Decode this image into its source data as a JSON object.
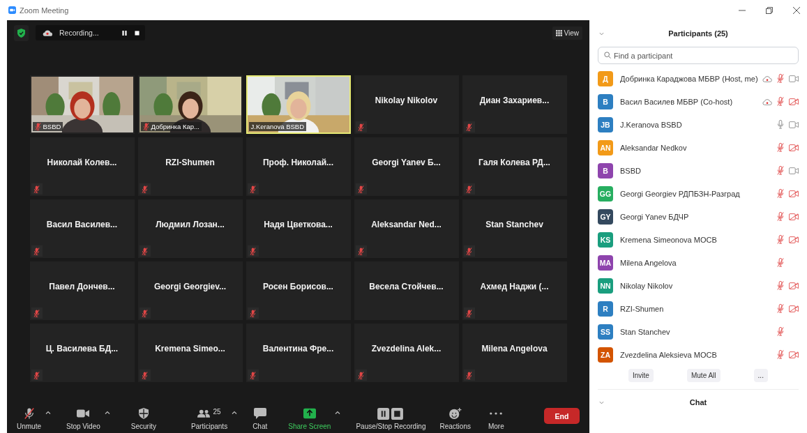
{
  "window": {
    "title": "Zoom Meeting"
  },
  "recording": {
    "label": "Recording..."
  },
  "view_button": {
    "label": "View"
  },
  "tiles": [
    {
      "name": "BSBD",
      "kind": "picture",
      "muted": true,
      "active": false
    },
    {
      "name": "Добринка Кар...",
      "kind": "picture",
      "muted": true,
      "active": false
    },
    {
      "name": "J.Keranova BSBD",
      "kind": "picture",
      "muted": false,
      "active": true
    },
    {
      "name": "Nikolay Nikolov",
      "kind": "name",
      "muted": true,
      "active": false
    },
    {
      "name": "Диан Захариев...",
      "kind": "name",
      "muted": true,
      "active": false
    },
    {
      "name": "Николай Колев...",
      "kind": "name",
      "muted": true,
      "active": false
    },
    {
      "name": "RZI-Shumen",
      "kind": "name",
      "muted": true,
      "active": false
    },
    {
      "name": "Проф. Николай...",
      "kind": "name",
      "muted": true,
      "active": false
    },
    {
      "name": "Georgi Yanev Б...",
      "kind": "name",
      "muted": true,
      "active": false
    },
    {
      "name": "Галя Колева РД...",
      "kind": "name",
      "muted": true,
      "active": false
    },
    {
      "name": "Васил Василев...",
      "kind": "name",
      "muted": true,
      "active": false
    },
    {
      "name": "Людмил Лозан...",
      "kind": "name",
      "muted": true,
      "active": false
    },
    {
      "name": "Надя Цветкова...",
      "kind": "name",
      "muted": true,
      "active": false
    },
    {
      "name": "Aleksandar Ned...",
      "kind": "name",
      "muted": true,
      "active": false
    },
    {
      "name": "Stan Stanchev",
      "kind": "name",
      "muted": true,
      "active": false
    },
    {
      "name": "Павел Дончев...",
      "kind": "name",
      "muted": true,
      "active": false
    },
    {
      "name": "Georgi Georgiev...",
      "kind": "name",
      "muted": true,
      "active": false
    },
    {
      "name": "Росен Борисов...",
      "kind": "name",
      "muted": true,
      "active": false
    },
    {
      "name": "Весела Стойчев...",
      "kind": "name",
      "muted": false,
      "active": false
    },
    {
      "name": "Ахмед Наджи (...",
      "kind": "name",
      "muted": true,
      "active": false
    },
    {
      "name": "Ц. Василева БД...",
      "kind": "name",
      "muted": true,
      "active": false
    },
    {
      "name": "Kremena Simeo...",
      "kind": "name",
      "muted": true,
      "active": false
    },
    {
      "name": "Валентина Фре...",
      "kind": "name",
      "muted": true,
      "active": false
    },
    {
      "name": "Zvezdelina Alek...",
      "kind": "name",
      "muted": true,
      "active": false
    },
    {
      "name": "Milena Angelova",
      "kind": "name",
      "muted": true,
      "active": false
    }
  ],
  "toolbar": [
    {
      "kind": "mic",
      "label": "Unmute",
      "muted": true,
      "caret": true
    },
    {
      "kind": "video",
      "label": "Stop Video",
      "caret": true
    },
    {
      "kind": "security",
      "label": "Security",
      "caret": false
    },
    {
      "kind": "participants",
      "label": "Participants",
      "count": "25",
      "caret": true
    },
    {
      "kind": "chat",
      "label": "Chat",
      "caret": false
    },
    {
      "kind": "share",
      "label": "Share Screen",
      "caret": true
    },
    {
      "kind": "record",
      "label": "Pause/Stop Recording",
      "caret": false
    },
    {
      "kind": "reactions",
      "label": "Reactions",
      "caret": false
    },
    {
      "kind": "more",
      "label": "More",
      "caret": false
    }
  ],
  "end_button": {
    "label": "End"
  },
  "participants_panel": {
    "title": "Participants (25)",
    "search": {
      "placeholder": "Find a participant"
    },
    "participants": [
      {
        "initials": "Д",
        "color": "#f29a18",
        "name": "Добринка Караджова МБВР (Host, me)",
        "recording": true,
        "mic_muted": true,
        "video_on": true
      },
      {
        "initials": "В",
        "color": "#2d7fc1",
        "name": "Васил Василев МБВР (Co-host)",
        "recording": true,
        "mic_muted": true,
        "video_on": false
      },
      {
        "initials": "JB",
        "color": "#2d7fc1",
        "name": "J.Keranova BSBD",
        "recording": false,
        "mic_muted": false,
        "video_on": true
      },
      {
        "initials": "AN",
        "color": "#f29a18",
        "name": "Aleksandar Nedkov",
        "recording": false,
        "mic_muted": true,
        "video_on": false
      },
      {
        "initials": "B",
        "color": "#8e44ad",
        "name": "BSBD",
        "recording": false,
        "mic_muted": true,
        "video_on": true
      },
      {
        "initials": "GG",
        "color": "#27ae60",
        "name": "Georgi Georgiev РДПБЗН-Разград",
        "recording": false,
        "mic_muted": true,
        "video_on": false
      },
      {
        "initials": "GY",
        "color": "#34495e",
        "name": "Georgi Yanev БДЧР",
        "recording": false,
        "mic_muted": true,
        "video_on": false
      },
      {
        "initials": "KS",
        "color": "#1a9e7e",
        "name": "Kremena Simeonova МОСВ",
        "recording": false,
        "mic_muted": true,
        "video_on": false
      },
      {
        "initials": "MA",
        "color": "#8e44ad",
        "name": "Milena Angelova",
        "recording": false,
        "mic_muted": true
      },
      {
        "initials": "NN",
        "color": "#1a9e7e",
        "name": "Nikolay Nikolov",
        "recording": false,
        "mic_muted": true,
        "video_on": false
      },
      {
        "initials": "R",
        "color": "#2d7fc1",
        "name": "RZI-Shumen",
        "recording": false,
        "mic_muted": true,
        "video_on": false
      },
      {
        "initials": "SS",
        "color": "#2d7fc1",
        "name": "Stan Stanchev",
        "recording": false,
        "mic_muted": true
      },
      {
        "initials": "ZA",
        "color": "#d35400",
        "name": "Zvezdelina Aleksieva МОСВ",
        "recording": false,
        "mic_muted": true,
        "video_on": false
      }
    ],
    "buttons": [
      "Invite",
      "Mute All",
      "..."
    ]
  },
  "chat_panel": {
    "title": "Chat"
  }
}
